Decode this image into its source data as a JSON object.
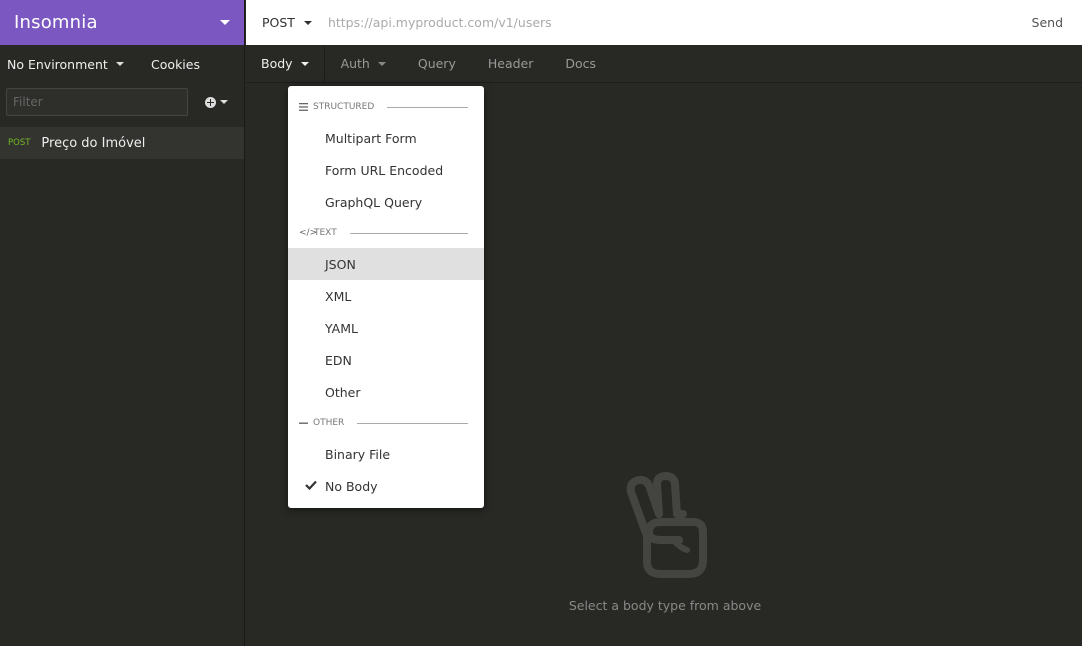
{
  "sidebar": {
    "title": "Insomnia",
    "environment": "No Environment",
    "cookies": "Cookies",
    "filter_placeholder": "Filter",
    "requests": [
      {
        "method": "POST",
        "name": "Preço do Imóvel"
      }
    ]
  },
  "urlbar": {
    "method": "POST",
    "url_placeholder": "https://api.myproduct.com/v1/users",
    "send": "Send"
  },
  "tabs": {
    "body": "Body",
    "auth": "Auth",
    "query": "Query",
    "header": "Header",
    "docs": "Docs"
  },
  "dropdown": {
    "structured_label": "Structured",
    "structured_items": [
      "Multipart Form",
      "Form URL Encoded",
      "GraphQL Query"
    ],
    "text_label": "Text",
    "text_items": [
      "JSON",
      "XML",
      "YAML",
      "EDN",
      "Other"
    ],
    "other_label": "Other",
    "other_items": [
      "Binary File",
      "No Body"
    ],
    "hovered": "JSON",
    "selected": "No Body"
  },
  "empty_state": {
    "message": "Select a body type from above"
  },
  "colors": {
    "brand": "#7b58c1",
    "background": "#282925",
    "post_method": "#75ba24"
  },
  "icons": {
    "empty_state": "peace-hand-icon",
    "add": "plus-circle-icon",
    "selected": "checkmark-icon"
  }
}
